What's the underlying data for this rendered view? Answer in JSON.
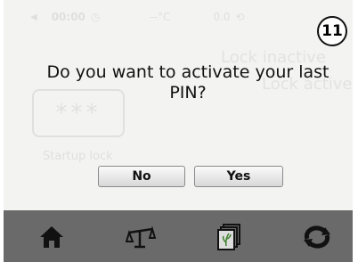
{
  "status_bar": {
    "time": "00:00",
    "temperature": "--°C",
    "speed": "0.0"
  },
  "background": {
    "lock_inactive_label": "Lock inactive",
    "lock_active_label": "Lock active",
    "pin_mask": "***",
    "startup_lock_label": "Startup lock"
  },
  "step_badge": "11",
  "dialog": {
    "message": "Do you want to activate your last PIN?",
    "no_label": "No",
    "yes_label": "Yes"
  },
  "nav": {
    "items": [
      {
        "icon": "home-icon"
      },
      {
        "icon": "scale-icon"
      },
      {
        "icon": "library-icon"
      },
      {
        "icon": "refresh-icon"
      }
    ]
  }
}
